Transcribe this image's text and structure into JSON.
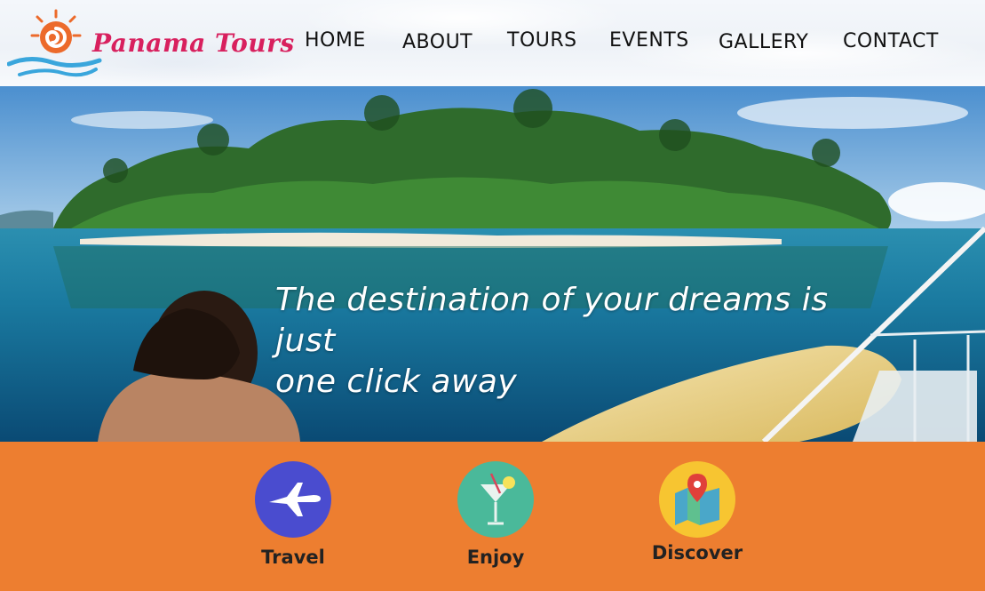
{
  "brand": {
    "name": "Panama Tours"
  },
  "nav": {
    "items": [
      {
        "label": "HOME"
      },
      {
        "label": "ABOUT"
      },
      {
        "label": "TOURS"
      },
      {
        "label": "EVENTS"
      },
      {
        "label": "GALLERY"
      },
      {
        "label": "CONTACT"
      }
    ]
  },
  "hero": {
    "tagline_line1": "The destination of your dreams is just",
    "tagline_line2": "one click away"
  },
  "features": [
    {
      "label": "Travel",
      "icon": "airplane-icon",
      "color": "#4a4ccf"
    },
    {
      "label": "Enjoy",
      "icon": "cocktail-icon",
      "color": "#4ab99a"
    },
    {
      "label": "Discover",
      "icon": "map-pin-icon",
      "color": "#f7c531"
    }
  ],
  "colors": {
    "brand": "#d8205e",
    "accent": "#ed7e30"
  }
}
